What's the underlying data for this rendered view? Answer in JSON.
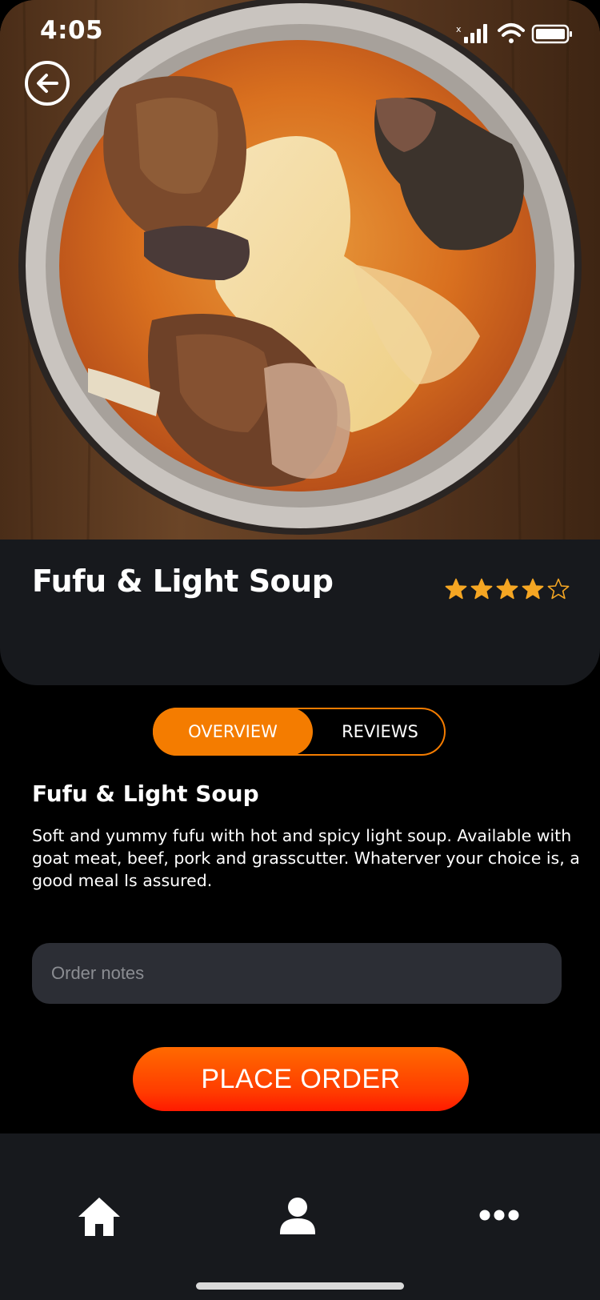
{
  "status_bar": {
    "time": "4:05"
  },
  "hero": {
    "image": "fufu-light-soup-bowl-photo"
  },
  "dish": {
    "title": "Fufu & Light Soup",
    "rating": 4,
    "rating_max": 5
  },
  "tabs": [
    {
      "label": "OVERVIEW",
      "active": true
    },
    {
      "label": "REVIEWS",
      "active": false
    }
  ],
  "overview": {
    "heading": "Fufu & Light Soup",
    "description": "Soft and yummy fufu with hot and spicy light soup. Available with goat meat, beef, pork and grasscutter. Whaterver your choice is, a good meal Is assured."
  },
  "order_notes": {
    "placeholder": "Order notes",
    "value": ""
  },
  "actions": {
    "place_order_label": "PLACE ORDER"
  },
  "bottom_nav": {
    "items": [
      {
        "icon": "home-icon"
      },
      {
        "icon": "user-icon"
      },
      {
        "icon": "more-icon"
      }
    ]
  },
  "colors": {
    "accent": "#f47c00",
    "button_gradient_top": "#ff6a00",
    "button_gradient_bottom": "#ff1a00",
    "star": "#f5a623",
    "card_bg": "#17191d",
    "input_bg": "#2c2e35"
  }
}
